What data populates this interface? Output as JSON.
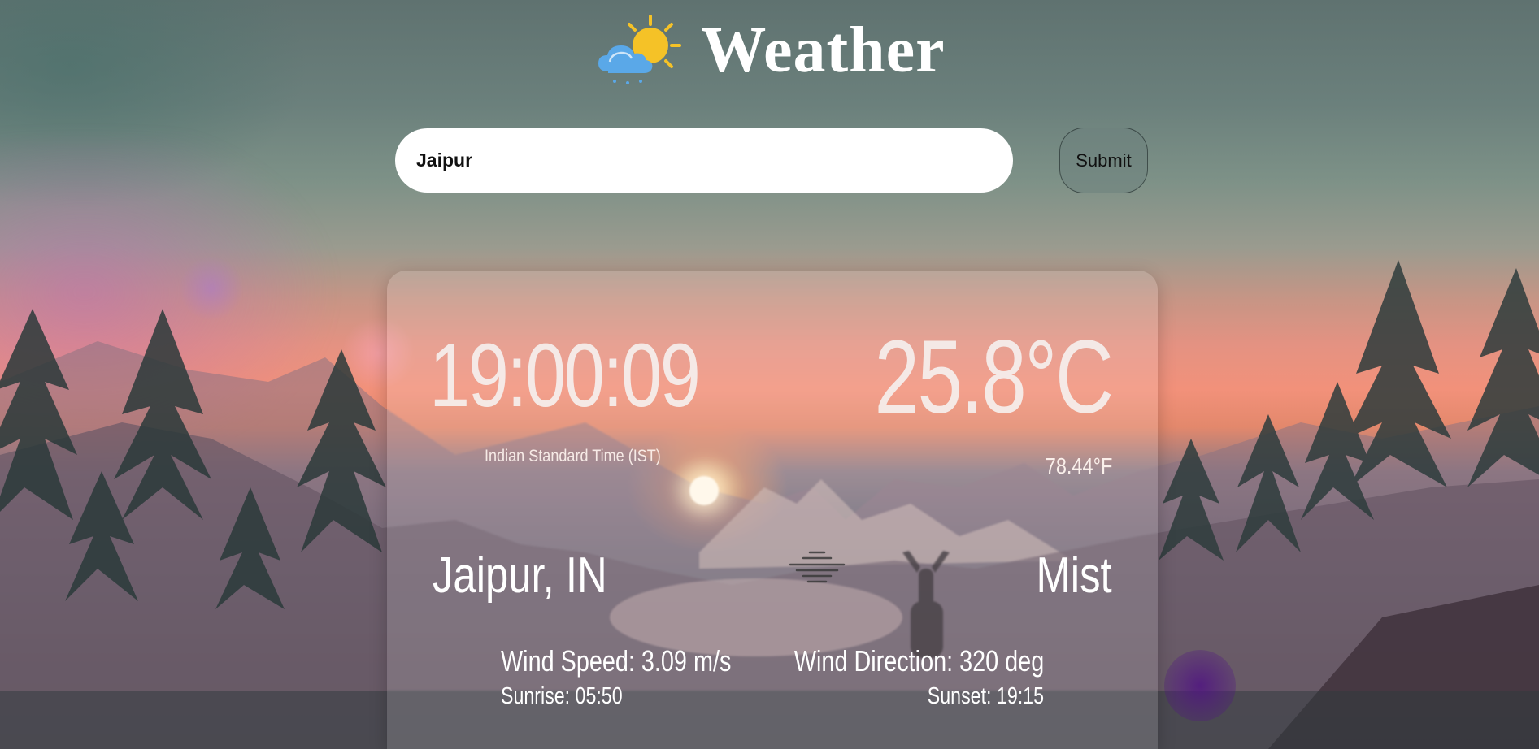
{
  "header": {
    "title": "Weather",
    "icon": "sun-behind-rain-cloud-icon"
  },
  "search": {
    "value": "Jaipur",
    "submit_label": "Submit"
  },
  "weather": {
    "local_time": "19:00:09",
    "timezone": "Indian Standard Time (IST)",
    "temp_c": "25.8°C",
    "temp_f": "78.44°F",
    "location": "Jaipur, IN",
    "condition": "Mist",
    "condition_icon": "mist-icon",
    "wind_speed": "Wind Speed: 3.09 m/s",
    "wind_direction": "Wind Direction: 320 deg",
    "sunrise": "Sunrise: 05:50",
    "sunset": "Sunset: 19:15"
  },
  "colors": {
    "card_text": "#ffffff",
    "sun_yellow": "#f5c227",
    "cloud_blue": "#5aa8e8"
  }
}
